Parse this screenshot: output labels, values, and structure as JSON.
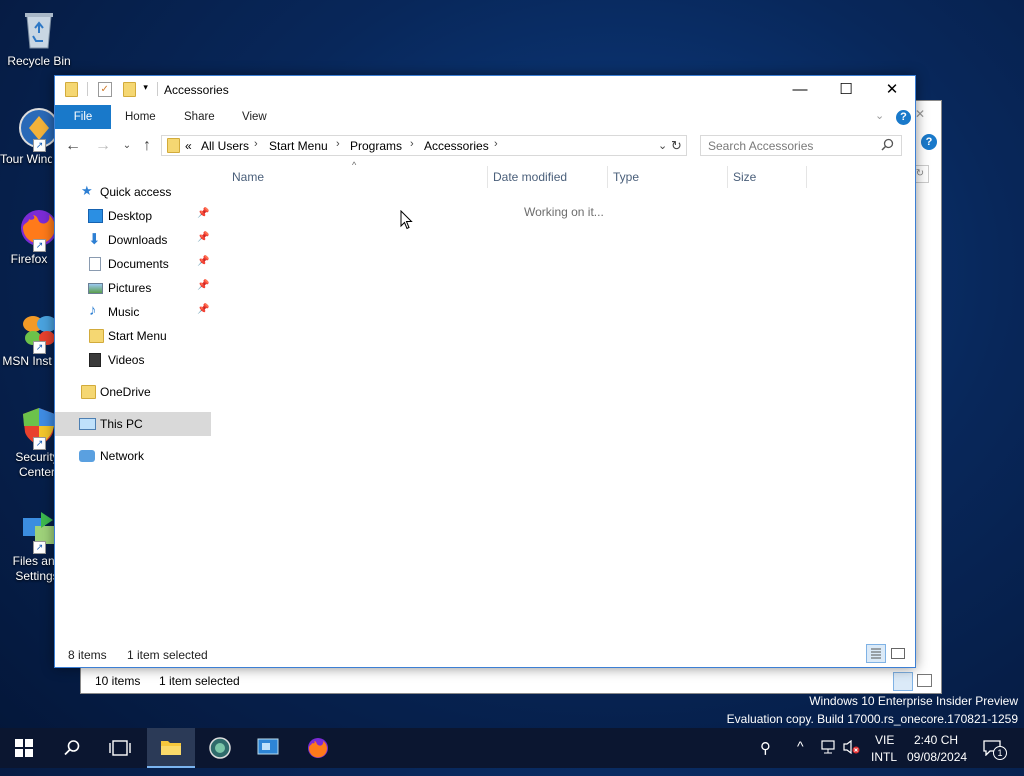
{
  "desktop": {
    "icons": [
      {
        "label": "Recycle Bin"
      },
      {
        "label": "Tour Windows"
      },
      {
        "label": "Firefox"
      },
      {
        "label": "MSN Inst"
      },
      {
        "label": "Security Center"
      },
      {
        "label": "Files and Settings"
      }
    ],
    "watermark": {
      "line1": "Windows 10 Enterprise Insider Preview",
      "line2": "Evaluation copy. Build 17000.rs_onecore.170821-1259"
    }
  },
  "background_window": {
    "status_items": "10 items",
    "status_selected": "1 item selected"
  },
  "window": {
    "title": "Accessories",
    "ribbon_tabs": [
      "File",
      "Home",
      "Share",
      "View"
    ],
    "breadcrumb": {
      "overflow": "«",
      "items": [
        "All Users",
        "Start Menu",
        "Programs",
        "Accessories"
      ]
    },
    "search_placeholder": "Search Accessories",
    "nav": {
      "quick_access": "Quick access",
      "items": [
        "Desktop",
        "Downloads",
        "Documents",
        "Pictures",
        "Music",
        "Start Menu",
        "Videos"
      ],
      "onedrive": "OneDrive",
      "this_pc": "This PC",
      "network": "Network"
    },
    "columns": [
      "Name",
      "Date modified",
      "Type",
      "Size"
    ],
    "loading_text": "Working on it...",
    "status_items": "8 items",
    "status_selected": "1 item selected"
  },
  "taskbar": {
    "language": "VIE",
    "layout": "INTL",
    "time": "2:40 CH",
    "date": "09/08/2024",
    "notification_count": "1"
  },
  "colors": {
    "accent": "#1979ca",
    "taskbar": "#0b1630",
    "folder": "#f5d772"
  }
}
